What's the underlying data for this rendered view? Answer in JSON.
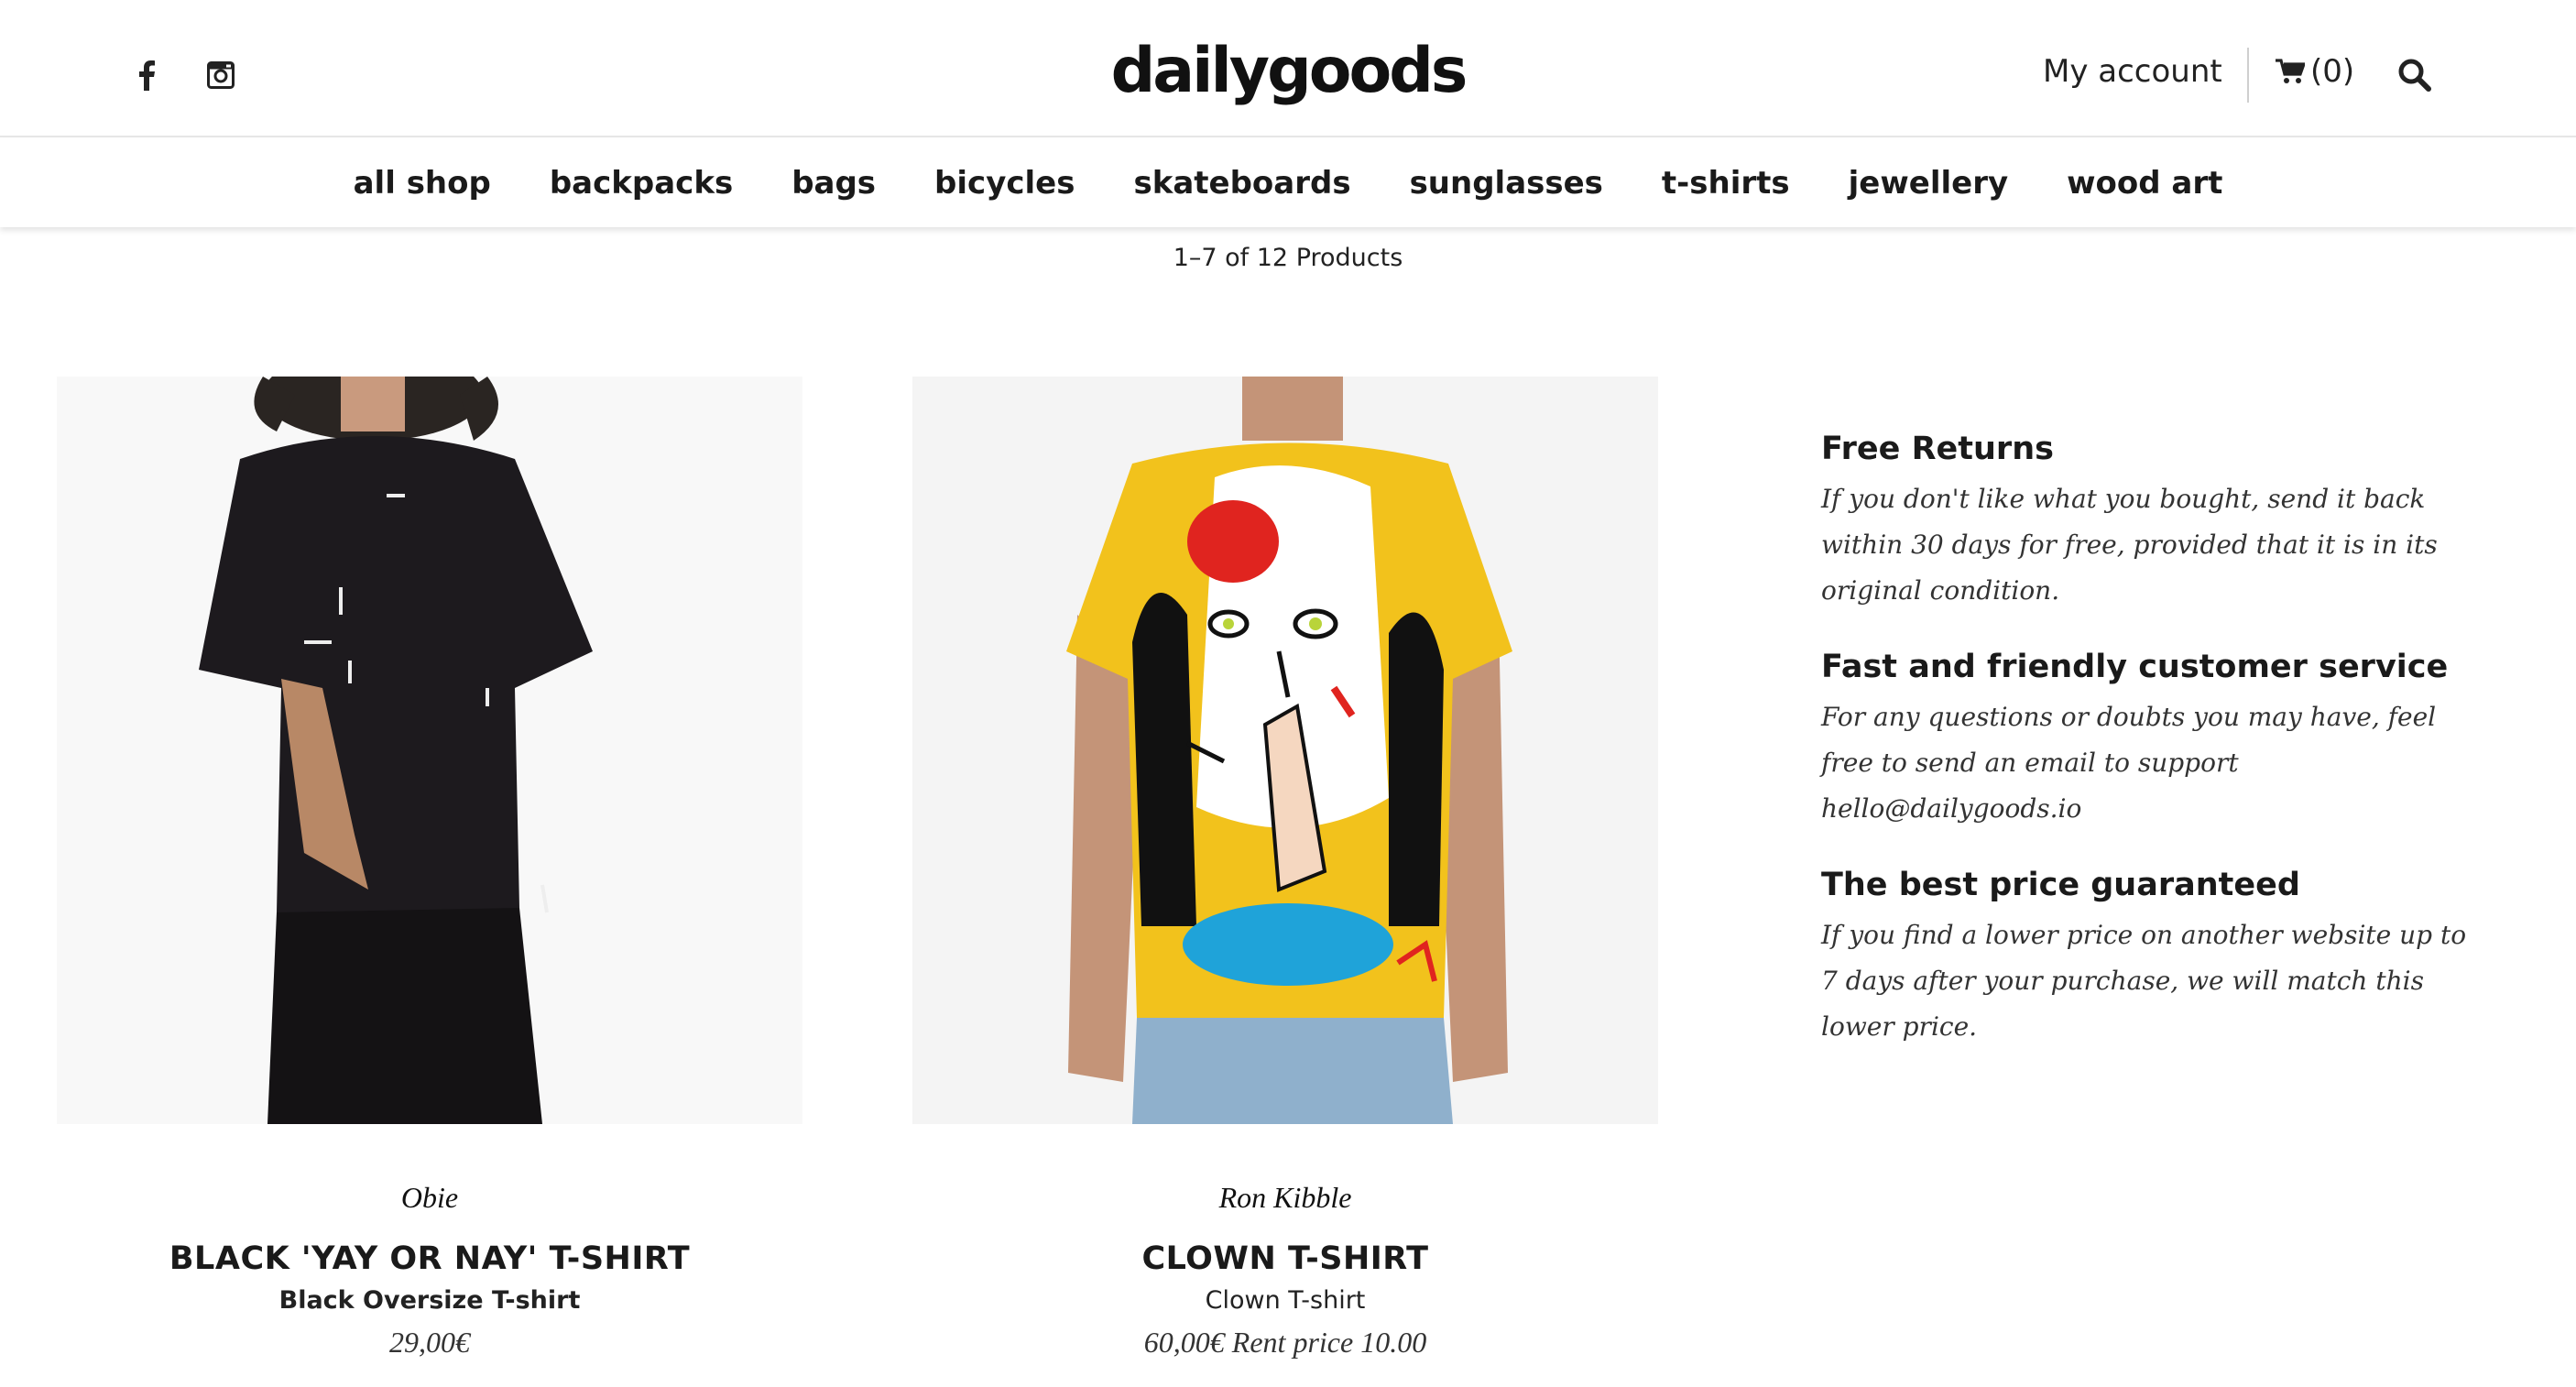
{
  "header": {
    "logo": "dailygoods",
    "social": [
      {
        "icon": "facebook-icon",
        "label": "f"
      },
      {
        "icon": "instagram-icon"
      }
    ],
    "my_account": "My account",
    "cart_count": "(0)",
    "cart_icon": "cart-icon",
    "search_icon": "search-icon"
  },
  "nav": {
    "items": [
      "all shop",
      "backpacks",
      "bags",
      "bicycles",
      "skateboards",
      "sunglasses",
      "t-shirts",
      "jewellery",
      "wood art"
    ]
  },
  "listing": {
    "count": "1–7 of 12 Products"
  },
  "products": [
    {
      "brand": "Obie",
      "title": "BLACK 'YAY OR NAY' T-SHIRT",
      "subtitle": "Black Oversize T-shirt",
      "price": "29,00€",
      "shirt_color": "#1d1a1e"
    },
    {
      "brand": "Ron Kibble",
      "title": "CLOWN T-SHIRT",
      "subtitle": "Clown T-shirt",
      "price": "60,00€ Rent price 10.00",
      "shirt_color": "#f2c21c"
    }
  ],
  "info": [
    {
      "heading": "Free Returns",
      "text": "If you don't like what you bought, send it back within 30 days for free, provided that it is in its original condition."
    },
    {
      "heading": "Fast and friendly customer service",
      "text": "For any questions or doubts you may have, feel free to send an email to support hello@dailygoods.io"
    },
    {
      "heading": "The best price guaranteed",
      "text": "If you find a lower price on another website up to 7 days after your purchase, we will match this lower price."
    }
  ]
}
